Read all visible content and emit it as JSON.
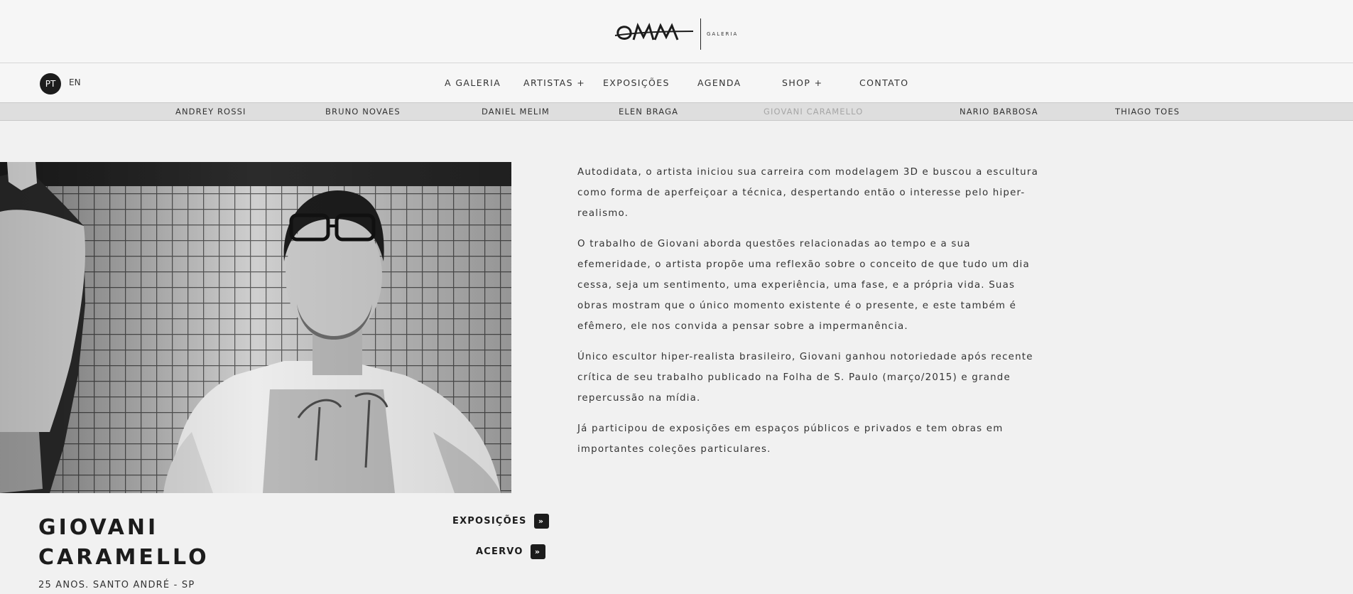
{
  "header": {
    "logo_text": "OMA",
    "logo_subtitle": "GALERIA"
  },
  "nav": {
    "lang_active": "PT",
    "lang_other": "EN",
    "items": [
      "A GALERIA",
      "ARTISTAS +",
      "EXPOSIÇÕES",
      "AGENDA",
      "SHOP +",
      "CONTATO"
    ]
  },
  "subnav": {
    "items": [
      "ANDREY ROSSI",
      "BRUNO NOVAES",
      "DANIEL MELIM",
      "ELEN BRAGA",
      "GIOVANI CARAMELLO",
      "NARIO BARBOSA",
      "THIAGO TOES"
    ],
    "active": "GIOVANI CARAMELLO"
  },
  "artist": {
    "name_line1": "GIOVANI",
    "name_line2": "CARAMELLO",
    "meta": "25 ANOS. SANTO ANDRÉ - SP",
    "links": [
      "EXPOSIÇÕES",
      "ACERVO"
    ],
    "link_icon": "double-chevron-right-icon"
  },
  "bio": {
    "paragraphs": [
      "Autodidata, o artista iniciou sua carreira com modelagem 3D e buscou a escultura como forma de aperfeiçoar a técnica, despertando então o interesse pelo hiper-realismo.",
      "O trabalho de Giovani aborda questões relacionadas ao tempo e a sua efemeridade, o artista propõe uma reflexão sobre o conceito de que tudo um dia cessa, seja um sentimento, uma experiência, uma fase, e a própria vida. Suas obras mostram que o único momento existente é o presente, e este também é efêmero, ele nos convida a pensar sobre a impermanência.",
      "Único escultor hiper-realista brasileiro, Giovani ganhou notoriedade após recente crítica de seu trabalho publicado na Folha de S. Paulo (março/2015) e grande repercussão na mídia.",
      "Já participou de exposições em espaços públicos e privados e tem obras em importantes coleções particulares."
    ]
  }
}
